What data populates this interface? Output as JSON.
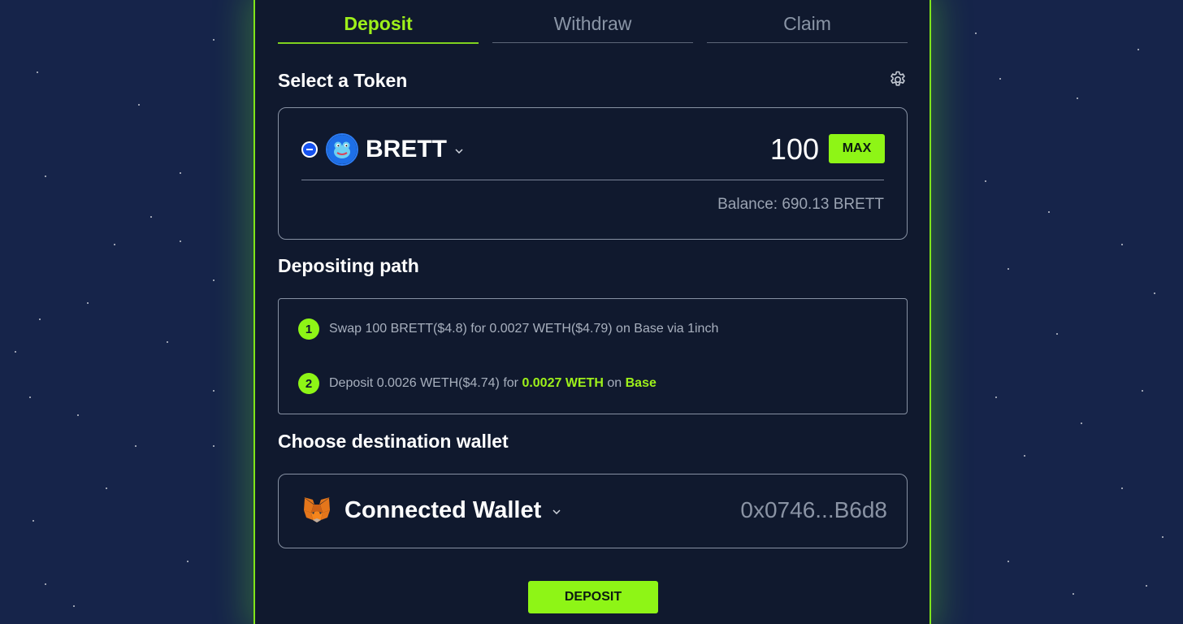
{
  "colors": {
    "accent": "#8ef516",
    "panel_bg": "#10192e",
    "page_bg": "#16244a",
    "muted_text": "#9aa3b2"
  },
  "tabs": [
    {
      "label": "Deposit",
      "active": true
    },
    {
      "label": "Withdraw",
      "active": false
    },
    {
      "label": "Claim",
      "active": false
    }
  ],
  "token_section": {
    "title": "Select a Token",
    "settings_icon": "gear-icon",
    "token": {
      "symbol": "BRETT",
      "logo_icon": "brett-token-icon",
      "chain_icon": "base-chain-icon"
    },
    "amount": "100",
    "max_label": "MAX",
    "balance": "Balance: 690.13 BRETT"
  },
  "path_section": {
    "title": "Depositing path",
    "steps": [
      {
        "number": "1",
        "text": "Swap 100 BRETT($4.8) for 0.0027 WETH($4.79) on Base via 1inch"
      },
      {
        "number": "2",
        "prefix": "Deposit 0.0026 WETH($4.74) for ",
        "highlight_amount": "0.0027 WETH",
        "middle": " on ",
        "highlight_chain": "Base"
      }
    ]
  },
  "wallet_section": {
    "title": "Choose destination wallet",
    "wallet_label": "Connected Wallet",
    "wallet_icon": "metamask-fox-icon",
    "address": "0x0746...B6d8"
  },
  "deposit_button": "DEPOSIT"
}
